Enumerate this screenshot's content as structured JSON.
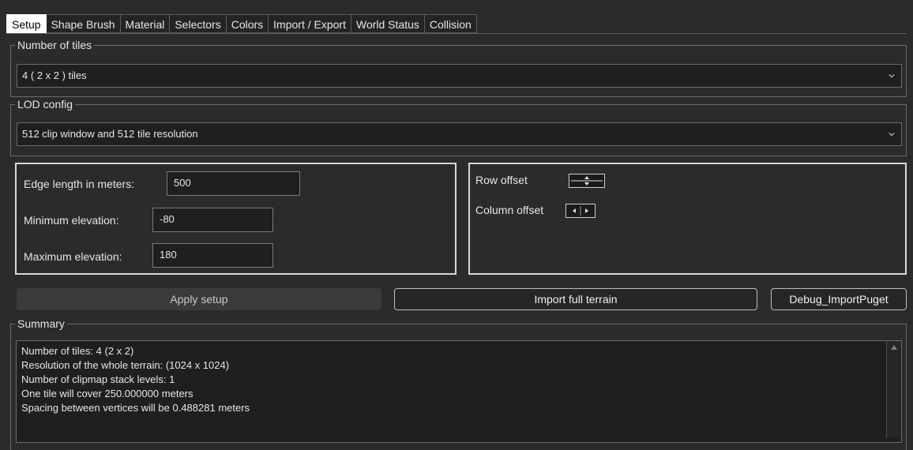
{
  "tabs": [
    {
      "label": "Setup",
      "active": true
    },
    {
      "label": "Shape Brush"
    },
    {
      "label": "Material"
    },
    {
      "label": "Selectors"
    },
    {
      "label": "Colors"
    },
    {
      "label": "Import / Export"
    },
    {
      "label": "World Status"
    },
    {
      "label": "Collision"
    }
  ],
  "tiles_group": {
    "title": "Number of tiles",
    "value": "4 ( 2 x 2 ) tiles"
  },
  "lod_group": {
    "title": "LOD config",
    "value": "512 clip window and 512 tile resolution"
  },
  "fields": {
    "edge_length": {
      "label": "Edge length in meters:",
      "value": "500"
    },
    "min_elevation": {
      "label": "Minimum elevation:",
      "value": "-80"
    },
    "max_elevation": {
      "label": "Maximum elevation:",
      "value": "180"
    }
  },
  "offsets": {
    "row_label": "Row offset",
    "column_label": "Column offset"
  },
  "buttons": {
    "apply": "Apply setup",
    "import": "Import full terrain",
    "debug": "Debug_ImportPuget"
  },
  "summary": {
    "title": "Summary",
    "lines": [
      "Number of tiles: 4 (2 x 2)",
      "Resolution of the whole terrain: (1024 x 1024)",
      "Number of clipmap stack levels: 1",
      "One tile will cover 250.000000 meters",
      "Spacing between vertices will be 0.488281 meters"
    ]
  },
  "icons": {
    "combo_arrow": "chevron-down-icon",
    "spin_vertical": "up-down-arrows-icon",
    "spin_horizontal": "left-right-arrows-icon",
    "scroll_up": "scroll-up-arrow-icon"
  }
}
